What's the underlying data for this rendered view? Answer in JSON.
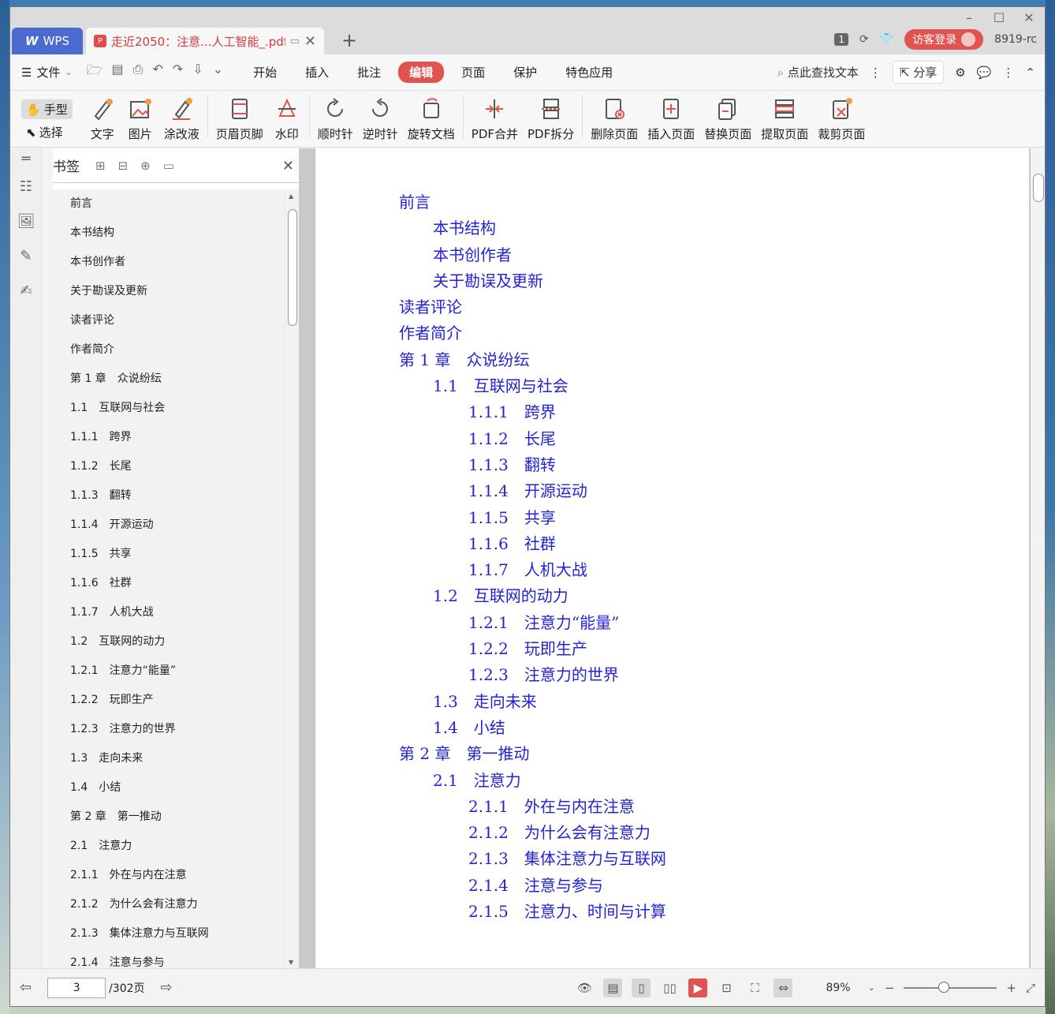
{
  "titlebar": {
    "wps_tab": "WPS",
    "doc_tab": "走近2050：注意...人工智能_.pdf",
    "badge": "1",
    "login": "访客登录",
    "version": "8919-rc"
  },
  "menubar": {
    "file": "文件",
    "tabs": [
      "开始",
      "插入",
      "批注",
      "编辑",
      "页面",
      "保护",
      "特色应用"
    ],
    "active_tab": "编辑",
    "search": "点此查找文本",
    "share": "分享"
  },
  "toolbar": {
    "hand": "手型",
    "select": "选择",
    "tools": [
      "文字",
      "图片",
      "涂改液",
      "页眉页脚",
      "水印",
      "顺时针",
      "逆时针",
      "旋转文档",
      "PDF合并",
      "PDF拆分",
      "删除页面",
      "插入页面",
      "替换页面",
      "提取页面",
      "裁剪页面"
    ]
  },
  "bookmarks": {
    "title": "书签",
    "items": [
      "前言",
      "本书结构",
      "本书创作者",
      "关于勘误及更新",
      "读者评论",
      "作者简介",
      "第 1 章　众说纷纭",
      "1.1　互联网与社会",
      "1.1.1　跨界",
      "1.1.2　长尾",
      "1.1.3　翻转",
      "1.1.4　开源运动",
      "1.1.5　共享",
      "1.1.6　社群",
      "1.1.7　人机大战",
      "1.2　互联网的动力",
      "1.2.1　注意力“能量”",
      "1.2.2　玩即生产",
      "1.2.3　注意力的世界",
      "1.3　走向未来",
      "1.4　小结",
      "第 2 章　第一推动",
      "2.1　注意力",
      "2.1.1　外在与内在注意",
      "2.1.2　为什么会有注意力",
      "2.1.3　集体注意力与互联网",
      "2.1.4　注意与参与"
    ]
  },
  "toc": [
    {
      "level": 1,
      "text": "前言"
    },
    {
      "level": 2,
      "text": "本书结构"
    },
    {
      "level": 2,
      "text": "本书创作者"
    },
    {
      "level": 2,
      "text": "关于勘误及更新"
    },
    {
      "level": 1,
      "text": "读者评论"
    },
    {
      "level": 1,
      "text": "作者简介"
    },
    {
      "level": 1,
      "text": "第 1 章　众说纷纭"
    },
    {
      "level": 2,
      "text": "1.1　互联网与社会"
    },
    {
      "level": 3,
      "text": "1.1.1　跨界"
    },
    {
      "level": 3,
      "text": "1.1.2　长尾"
    },
    {
      "level": 3,
      "text": "1.1.3　翻转"
    },
    {
      "level": 3,
      "text": "1.1.4　开源运动"
    },
    {
      "level": 3,
      "text": "1.1.5　共享"
    },
    {
      "level": 3,
      "text": "1.1.6　社群"
    },
    {
      "level": 3,
      "text": "1.1.7　人机大战"
    },
    {
      "level": 2,
      "text": "1.2　互联网的动力"
    },
    {
      "level": 3,
      "text": "1.2.1　注意力“能量”"
    },
    {
      "level": 3,
      "text": "1.2.2　玩即生产"
    },
    {
      "level": 3,
      "text": "1.2.3　注意力的世界"
    },
    {
      "level": 2,
      "text": "1.3　走向未来"
    },
    {
      "level": 2,
      "text": "1.4　小结"
    },
    {
      "level": 1,
      "text": "第 2 章　第一推动"
    },
    {
      "level": 2,
      "text": "2.1　注意力"
    },
    {
      "level": 3,
      "text": "2.1.1　外在与内在注意"
    },
    {
      "level": 3,
      "text": "2.1.2　为什么会有注意力"
    },
    {
      "level": 3,
      "text": "2.1.3　集体注意力与互联网"
    },
    {
      "level": 3,
      "text": "2.1.4　注意与参与"
    },
    {
      "level": 3,
      "text": "2.1.5　注意力、时间与计算"
    }
  ],
  "status": {
    "page": "3",
    "total": "/302页",
    "zoom": "89%"
  },
  "colors": {
    "accent": "#e0544f",
    "toc_link": "#2323d6",
    "wps_tab": "#4b6bd0"
  }
}
